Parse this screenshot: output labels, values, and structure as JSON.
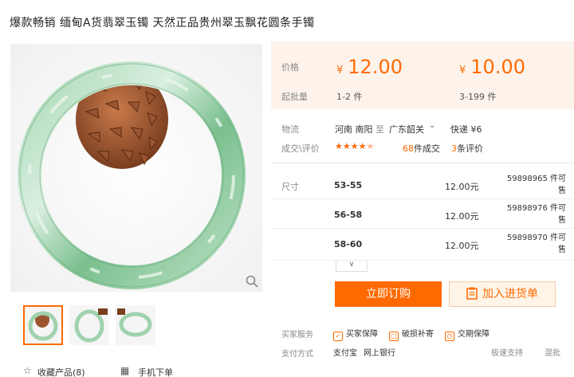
{
  "title": "爆款畅销  缅甸A货翡翠玉镯  天然正品贵州翠玉飘花圆条手镯",
  "price_box": {
    "price_label": "价格",
    "qty_label": "起批量",
    "tiers": [
      {
        "currency": "¥",
        "price": "12.00",
        "qty": "1-2 件"
      },
      {
        "currency": "¥",
        "price": "10.00",
        "qty": "3-199 件"
      }
    ]
  },
  "logistics": {
    "label": "物流",
    "from": "河南 南阳",
    "to_word": "至",
    "to": "广东韶关",
    "shipping": "快递 ¥6"
  },
  "reviews": {
    "label": "成交\\评价",
    "rating": 4.5,
    "deals_count": "68",
    "deals_suffix": "件成交",
    "review_count": "3",
    "review_suffix": "条评价"
  },
  "sku": {
    "label": "尺寸",
    "rows": [
      {
        "size": "53-55",
        "price": "12.00元",
        "stock": "59898965 件可售"
      },
      {
        "size": "56-58",
        "price": "12.00元",
        "stock": "59898976 件可售"
      },
      {
        "size": "58-60",
        "price": "12.00元",
        "stock": "59898970 件可售"
      }
    ]
  },
  "buttons": {
    "order": "立即订购",
    "cart": "加入进货单"
  },
  "services": {
    "label": "买家服务",
    "items": [
      "买家保障",
      "破损补寄",
      "交期保障"
    ]
  },
  "payment": {
    "label": "支付方式",
    "items": [
      "支付宝",
      "网上银行"
    ],
    "extra": [
      "极速支持",
      "混批"
    ]
  },
  "bottom": {
    "favorite": "收藏产品(8)",
    "mobile": "手机下单"
  },
  "colors": {
    "accent": "#ff6a00",
    "price_bg": "#fdf3eb",
    "jade": "#8fc9a0"
  }
}
